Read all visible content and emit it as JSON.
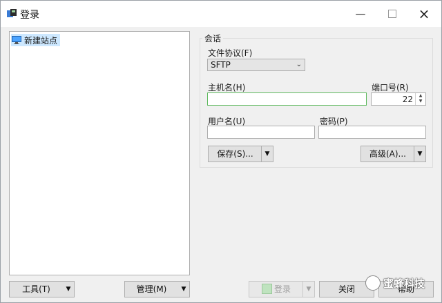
{
  "window": {
    "title": "登录"
  },
  "tree": {
    "items": [
      {
        "label": "新建站点"
      }
    ]
  },
  "session": {
    "group_title": "会话",
    "protocol_label": "文件协议(F)",
    "protocol_value": "SFTP",
    "host_label": "主机名(H)",
    "host_value": "",
    "port_label": "端口号(R)",
    "port_value": "22",
    "user_label": "用户名(U)",
    "user_value": "",
    "password_label": "密码(P)",
    "password_value": "",
    "save_button": "保存(S)...",
    "advanced_button": "高级(A)..."
  },
  "footer": {
    "tools_button": "工具(T)",
    "manage_button": "管理(M)",
    "login_button": "登录",
    "close_button": "关闭",
    "help_button": "帮助"
  },
  "watermark": {
    "text": "蜜蜂科技"
  }
}
